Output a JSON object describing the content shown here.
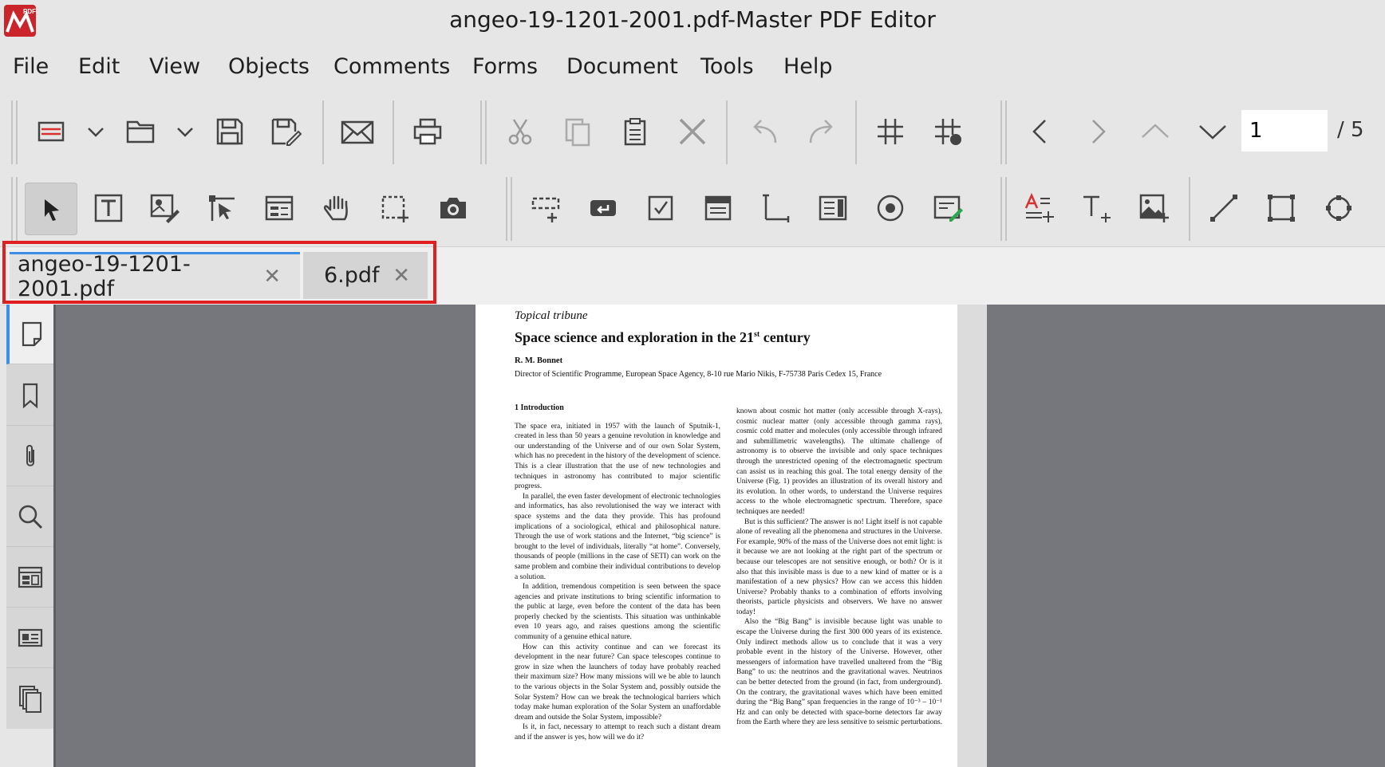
{
  "window": {
    "title": "angeo-19-1201-2001.pdf-Master PDF Editor",
    "logo_text": "PDF"
  },
  "menu": [
    "File",
    "Edit",
    "View",
    "Objects",
    "Comments",
    "Forms",
    "Document",
    "Tools",
    "Help"
  ],
  "toolbar1": {
    "icons": [
      "new-document-icon",
      "new-dropdown-icon",
      "open-folder-icon",
      "open-dropdown-icon",
      "save-icon",
      "save-as-icon",
      "email-icon",
      "print-icon",
      "cut-icon",
      "copy-icon",
      "paste-icon",
      "delete-icon",
      "undo-icon",
      "redo-icon",
      "grid-icon",
      "snap-to-grid-icon",
      "previous-page-icon",
      "next-page-icon",
      "first-page-icon",
      "last-page-icon"
    ],
    "page_number": "1",
    "page_total": "/ 5"
  },
  "toolbar2": {
    "icons": [
      "select-tool-icon",
      "edit-text-icon",
      "edit-object-icon",
      "select-object-icon",
      "form-object-icon",
      "hand-tool-icon",
      "marquee-select-icon",
      "snapshot-icon",
      "text-field-icon",
      "button-field-icon",
      "checkbox-field-icon",
      "list-field-icon",
      "combobox-field-icon",
      "listbox-field-icon",
      "radio-field-icon",
      "signature-field-icon",
      "add-text-annotation-icon",
      "add-text-icon",
      "add-image-icon",
      "line-tool-icon",
      "rectangle-tool-icon",
      "polygon-tool-icon"
    ]
  },
  "tabs": [
    {
      "label": "angeo-19-1201-2001.pdf",
      "active": true
    },
    {
      "label": "6.pdf",
      "active": false
    }
  ],
  "sidebar": [
    "page-thumbnails-icon",
    "bookmarks-icon",
    "attachments-icon",
    "search-icon",
    "layers-icon",
    "signatures-icon",
    "pages-icon"
  ],
  "document": {
    "kicker": "Topical tribune",
    "title": "Space science and exploration in the 21",
    "title_sup": "st",
    "title_end": " century",
    "author": "R. M. Bonnet",
    "affiliation": "Director of Scientific Programme, European Space Agency, 8-10 rue Mario Nikis, F-75738 Paris Cedex 15, France",
    "section_heading": "1    Introduction",
    "left_paragraphs": [
      "The space era, initiated in 1957 with the launch of Sputnik-1, created in less than 50 years a genuine revolution in knowledge and our understanding of the Universe and of our own Solar System, which has no precedent in the history of the development of science. This is a clear illustration that the use of new technologies and techniques in astronomy has contributed to major scientific progress.",
      "In parallel, the even faster development of electronic technologies and informatics, has also revolutionised the way we interact with space systems and the data they provide. This has profound implications of a sociological, ethical and philosophical nature. Through the use of work stations and the Internet, “big science” is brought to the level of individuals, literally “at home”. Conversely, thousands of people (millions in the case of SETI) can work on the same problem and combine their individual contributions to develop a solution.",
      "In addition, tremendous competition is seen between the space agencies and private institutions to bring scientific information to the public at large, even before the content of the data has been properly checked by the scientists. This situation was unthinkable even 10 years ago, and raises questions among the scientific community of a genuine ethical nature.",
      "How can this activity continue and can we forecast its development in the near future? Can space telescopes continue to grow in size when the launchers of today have probably reached their maximum size? How many missions will we be able to launch to the various objects in the Solar System and, possibly outside the Solar System? How can we break the technological barriers which today make human exploration of the Solar System an unaffordable dream and outside the Solar System, impossible?",
      "Is it, in fact, necessary to attempt to reach such a distant dream and if the answer is yes, how will we do it?"
    ],
    "right_paragraphs": [
      "known about cosmic hot matter (only accessible through X-rays), cosmic nuclear matter (only accessible through gamma rays), cosmic cold matter and molecules (only accessible through infrared and submillimetric wavelengths). The ultimate challenge of astronomy is to observe the invisible and only space techniques through the unrestricted opening of the electromagnetic spectrum can assist us in reaching this goal. The total energy density of the Universe (Fig. 1) provides an illustration of its overall history and its evolution. In other words, to understand the Universe requires access to the whole electromagnetic spectrum. Therefore, space techniques are needed!",
      "But is this sufficient? The answer is no! Light itself is not capable alone of revealing all the phenomena and structures in the Universe. For example, 90% of the mass of the Universe does not emit light: is it because we are not looking at the right part of the spectrum or because our telescopes are not sensitive enough, or both? Or is it also that this invisible mass is due to a new kind of matter or is a manifestation of a new physics? How can we access this hidden Universe? Probably thanks to a combination of efforts involving theorists, particle physicists and observers. We have no answer today!",
      "Also the “Big Bang” is invisible because light was unable to escape the Universe during the first 300 000 years of its existence. Only indirect methods allow us to conclude that it was a very probable event in the history of the Universe. However, other messengers of information have travelled unaltered from the “Big Bang” to us: the neutrinos and the gravitational waves. Neutrinos can be better detected from the ground (in fact, from underground). On the contrary, the gravitational waves which have been emitted during the “Big Bang” span frequencies in the range of 10⁻³ – 10⁻¹ Hz and can only be detected with space-borne detectors far away from the Earth where they are less sensitive to seismic perturbations."
    ]
  }
}
